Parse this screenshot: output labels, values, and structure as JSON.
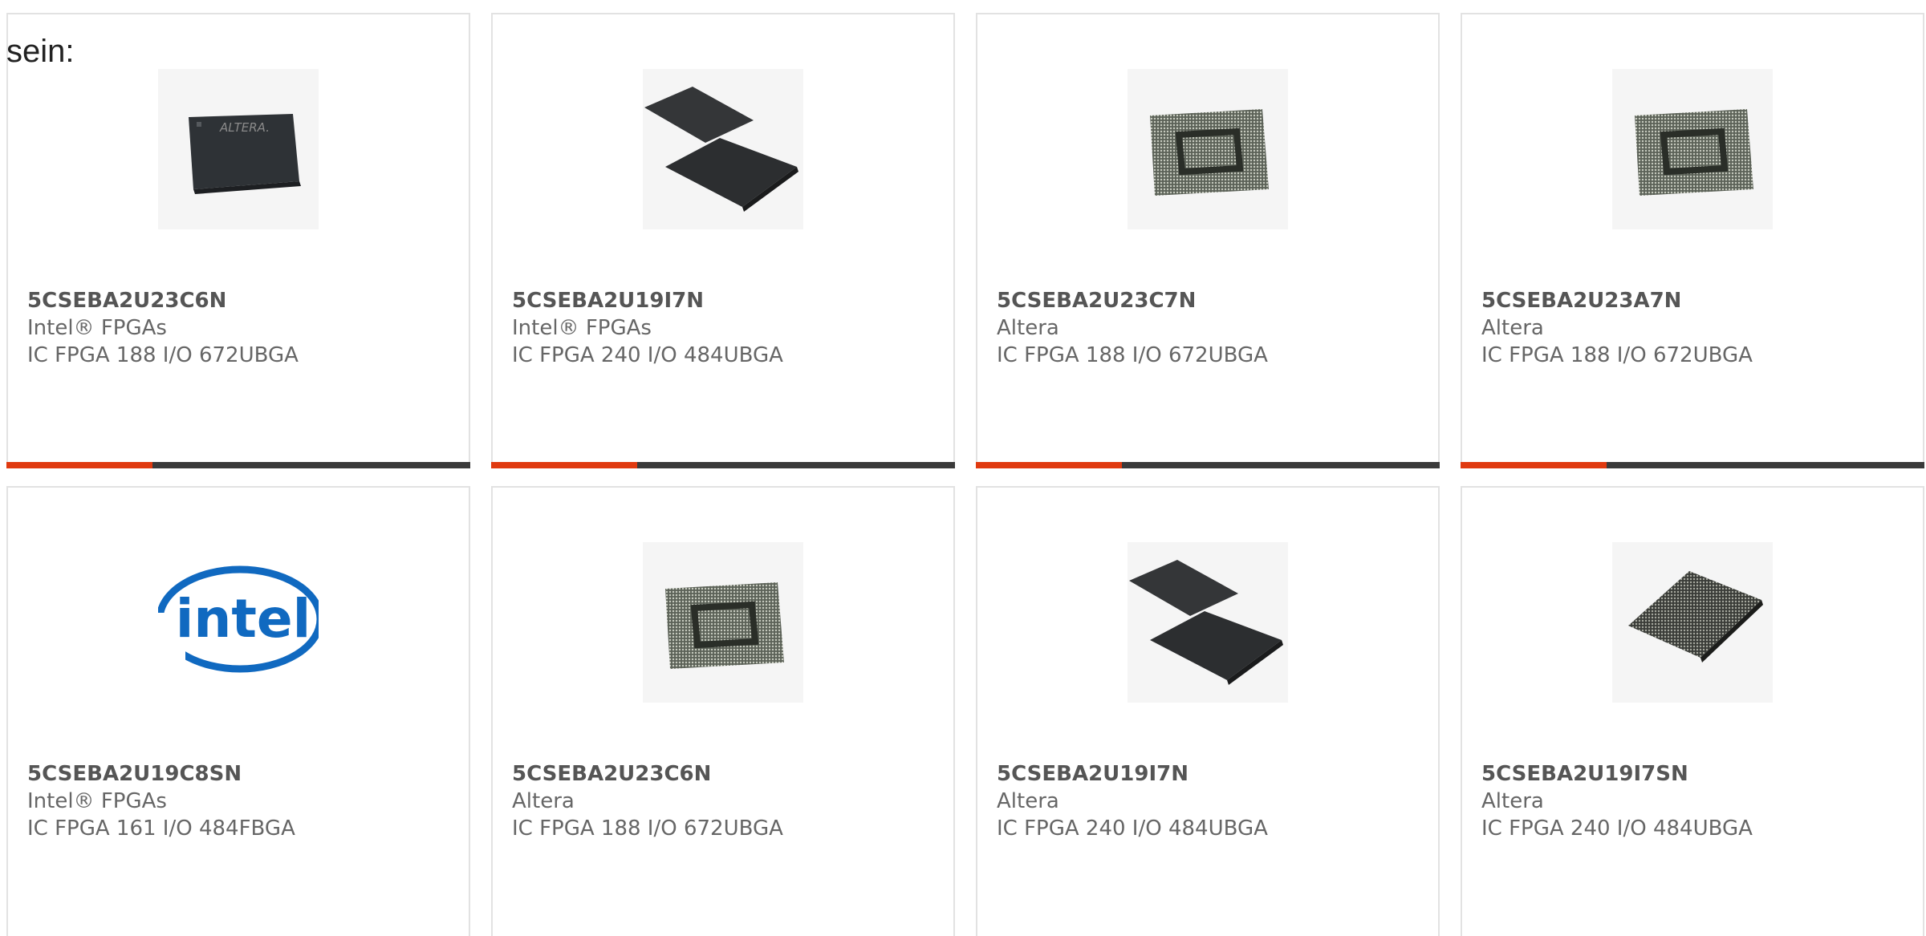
{
  "intro": "sein:",
  "colors": {
    "accent": "#e03a10",
    "bar": "#3a3a3a",
    "border": "#e2e2e2"
  },
  "cards": [
    {
      "part": "5CSEBA2U23C6N",
      "mfr": "Intel® FPGAs",
      "desc": "IC FPGA 188 I/O 672UBGA",
      "image": "chip-logo-top"
    },
    {
      "part": "5CSEBA2U19I7N",
      "mfr": "Intel® FPGAs",
      "desc": "IC FPGA 240 I/O 484UBGA",
      "image": "chip-pair"
    },
    {
      "part": "5CSEBA2U23C7N",
      "mfr": "Altera",
      "desc": "IC FPGA 188 I/O 672UBGA",
      "image": "bga-square"
    },
    {
      "part": "5CSEBA2U23A7N",
      "mfr": "Altera",
      "desc": "IC FPGA 188 I/O 672UBGA",
      "image": "bga-square"
    },
    {
      "part": "5CSEBA2U19C8SN",
      "mfr": "Intel® FPGAs",
      "desc": "IC FPGA 161 I/O 484FBGA",
      "image": "intel-logo"
    },
    {
      "part": "5CSEBA2U23C6N",
      "mfr": "Altera",
      "desc": "IC FPGA 188 I/O 672UBGA",
      "image": "bga-square"
    },
    {
      "part": "5CSEBA2U19I7N",
      "mfr": "Altera",
      "desc": "IC FPGA 240 I/O 484UBGA",
      "image": "chip-pair"
    },
    {
      "part": "5CSEBA2U19I7SN",
      "mfr": "Altera",
      "desc": "IC FPGA 240 I/O 484UBGA",
      "image": "bga-diamond"
    }
  ],
  "logo_text": "intel"
}
